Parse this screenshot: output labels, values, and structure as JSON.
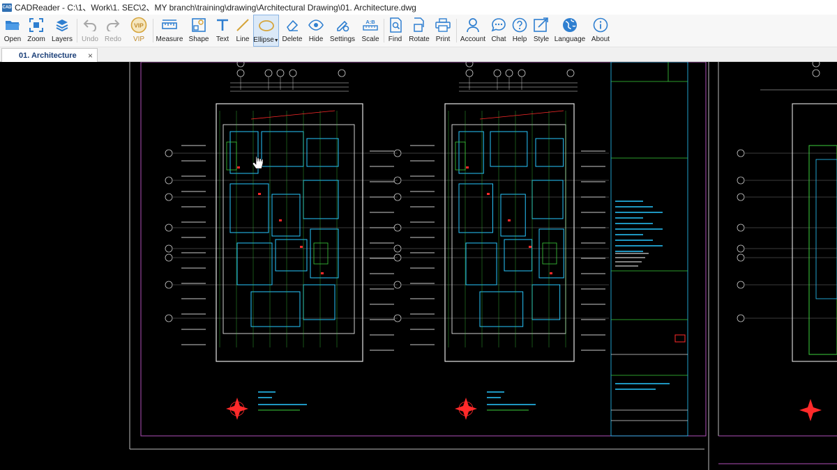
{
  "window": {
    "title": "CADReader - C:\\1、Work\\1. SEC\\2、MY branch\\training\\drawing\\Architectural Drawing\\01. Architecture.dwg",
    "logo_text": "CAD"
  },
  "toolbar": {
    "open": "Open",
    "zoom": "Zoom",
    "layers": "Layers",
    "undo": "Undo",
    "redo": "Redo",
    "vip": "VIP",
    "measure": "Measure",
    "shape": "Shape",
    "text": "Text",
    "line": "Line",
    "ellipse": "Ellipse",
    "delete": "Delete",
    "hide": "Hide",
    "settings": "Settings",
    "scale": "Scale",
    "find": "Find",
    "rotate": "Rotate",
    "print": "Print",
    "account": "Account",
    "chat": "Chat",
    "help": "Help",
    "style": "Style",
    "language": "Language",
    "about": "About",
    "vip_badge": "VIP",
    "scale_badge": "A:B"
  },
  "tabs": [
    {
      "label": "01. Architecture",
      "close": "×"
    }
  ],
  "colors": {
    "accent": "#2f7fd0",
    "vip": "#d6a43a",
    "cad_white": "#e6e6e6",
    "cad_cyan": "#29c7ff",
    "cad_green": "#3ccf3c",
    "cad_magenta": "#b04fb8",
    "cad_red": "#ff2a2a"
  }
}
